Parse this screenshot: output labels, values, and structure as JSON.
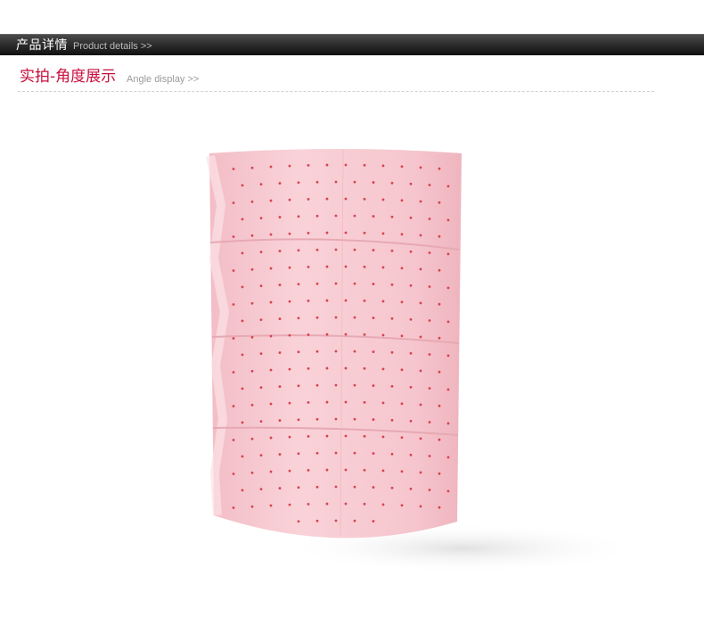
{
  "header": {
    "title": "产品详情",
    "subtitle": "Product details >>"
  },
  "section": {
    "title": "实拍-角度展示",
    "subtitle": "Angle display >>"
  },
  "photo": {
    "subject": "pink-perforated-absorbent-roll-icon",
    "colors": {
      "roll": "#f7c7cf",
      "perforation": "#d9424f",
      "shadow": "#eeeeee"
    }
  }
}
